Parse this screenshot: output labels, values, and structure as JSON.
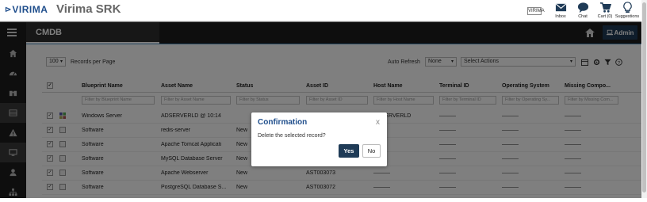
{
  "header": {
    "logo_text": "VIRIMA",
    "app_title": "Virima SRK",
    "brand_badge": "VIRIMA",
    "actions": [
      {
        "label": "Inbox",
        "icon": "envelope-icon"
      },
      {
        "label": "Chat",
        "icon": "chat-icon"
      },
      {
        "label": "Cart (0)",
        "icon": "cart-icon"
      },
      {
        "label": "Suggestions",
        "icon": "lightbulb-icon"
      }
    ]
  },
  "navbar": {
    "title": "CMDB",
    "admin_label": "Admin"
  },
  "sidebar": {
    "items": [
      "home-icon",
      "dashboard-icon",
      "binoculars-icon",
      "table-icon",
      "warning-icon",
      "monitor-icon",
      "user-icon",
      "hierarchy-icon"
    ]
  },
  "controls": {
    "page_size": "100",
    "page_size_label": "Records per Page",
    "auto_refresh_label": "Auto Refresh",
    "auto_refresh_value": "None",
    "actions_placeholder": "Select Actions"
  },
  "grid": {
    "columns": [
      "Blueprint Name",
      "Asset Name",
      "Status",
      "Asset ID",
      "Host Name",
      "Terminal ID",
      "Operating System",
      "Missing Compo..."
    ],
    "filters": [
      "Filter by Blueprint Name",
      "Filter by Asset Name",
      "Filter by Status",
      "Filter by Asset ID",
      "Filter by Host Name",
      "Filter by Terminal ID",
      "Filter by Operating Sy...",
      "Filter by Missing Com..."
    ],
    "rows": [
      {
        "blueprint": "Windows Server",
        "asset_name": "ADSERVERLD @ 10:14",
        "status": "",
        "asset_id": "",
        "host": "ADSERVERLD",
        "terminal": "———",
        "os": "———",
        "missing": "———"
      },
      {
        "blueprint": "Software",
        "asset_name": "redis-server",
        "status": "New",
        "asset_id": "",
        "host": "",
        "terminal": "———",
        "os": "———",
        "missing": "———"
      },
      {
        "blueprint": "Software",
        "asset_name": "Apache Tomcat Applicati",
        "status": "New",
        "asset_id": "",
        "host": "",
        "terminal": "———",
        "os": "———",
        "missing": "———"
      },
      {
        "blueprint": "Software",
        "asset_name": "MySQL Database Server",
        "status": "New",
        "asset_id": "",
        "host": "",
        "terminal": "———",
        "os": "———",
        "missing": "———"
      },
      {
        "blueprint": "Software",
        "asset_name": "Apache Webserver",
        "status": "New",
        "asset_id": "AST003073",
        "host": "———",
        "terminal": "———",
        "os": "———",
        "missing": "———"
      },
      {
        "blueprint": "Software",
        "asset_name": "PostgreSQL Database S...",
        "status": "New",
        "asset_id": "AST003072",
        "host": "———",
        "terminal": "———",
        "os": "———",
        "missing": "———"
      }
    ]
  },
  "modal": {
    "title": "Confirmation",
    "close": "x",
    "message": "Delete the selected record?",
    "yes_label": "Yes",
    "no_label": "No"
  }
}
